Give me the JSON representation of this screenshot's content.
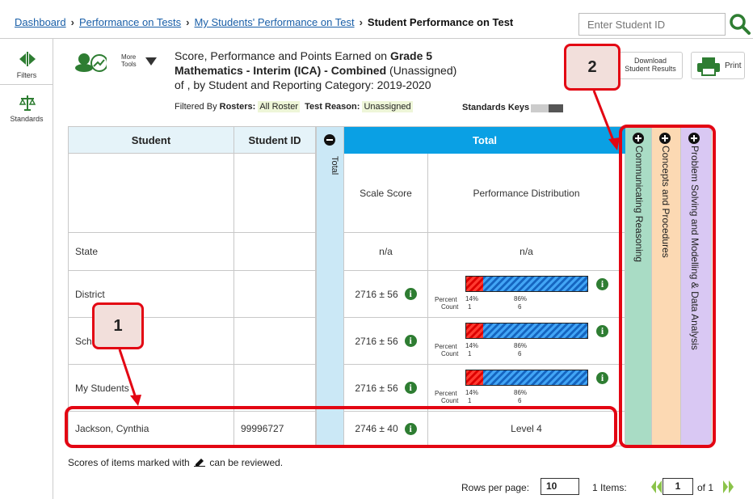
{
  "breadcrumb": {
    "items": [
      "Dashboard",
      "Performance on Tests",
      "My Students' Performance on Test"
    ],
    "current": "Student Performance on Test"
  },
  "search": {
    "placeholder": "Enter Student ID"
  },
  "rail": {
    "filters_label": "Filters",
    "standards_label": "Standards"
  },
  "toolbar": {
    "more_tools_label": "More Tools",
    "download_label_1": "Download",
    "download_label_2": "Student Results",
    "print_label": "Print"
  },
  "report": {
    "title_prefix": "Score, Performance and Points Earned on ",
    "title_grade": "Grade 5",
    "title_test": "Mathematics - Interim (ICA) - Combined",
    "title_suffix": " (Unassigned)",
    "title_line3": "of , by Student and Reporting Category: 2019-2020",
    "filtered_by": "Filtered By",
    "rosters_label": "Rosters:",
    "rosters_value": "All Roster",
    "reason_label": "Test Reason:",
    "reason_value": "Unassigned",
    "standards_keys": "Standards Keys"
  },
  "table": {
    "col_student": "Student",
    "col_student_id": "Student ID",
    "col_total_vertical": "Total",
    "total_banner": "Total",
    "col_scale_score": "Scale Score",
    "col_perf_dist": "Performance Distribution",
    "rows": [
      {
        "student": "State",
        "student_id": "",
        "score": "n/a",
        "dist_text": "n/a"
      },
      {
        "student": "District",
        "student_id": "",
        "score": "2716 ± 56",
        "pct_left": "14%",
        "pct_right": "86%",
        "cnt_left": "1",
        "cnt_right": "6"
      },
      {
        "student": "School",
        "student_id": "",
        "score": "2716 ± 56",
        "pct_left": "14%",
        "pct_right": "86%",
        "cnt_left": "1",
        "cnt_right": "6"
      },
      {
        "student": "My Students",
        "student_id": "",
        "score": "2716 ± 56",
        "pct_left": "14%",
        "pct_right": "86%",
        "cnt_left": "1",
        "cnt_right": "6"
      },
      {
        "student": "Jackson, Cynthia",
        "student_id": "99996727",
        "score": "2746 ± 40",
        "dist_text": "Level 4"
      }
    ],
    "percent_label": "Percent",
    "count_label": "Count",
    "dist_fraction_red": 0.14,
    "categories": [
      {
        "label": "Communicating Reasoning",
        "color": "#a9dcc5"
      },
      {
        "label": "Concepts and Procedures",
        "color": "#fcd9b3"
      },
      {
        "label": "Problem Solving and Modelling & Data Analysis",
        "color": "#d9c8f3"
      }
    ]
  },
  "callouts": {
    "one": "1",
    "two": "2"
  },
  "footer": {
    "note_before": "Scores of items marked with",
    "note_after": "can be reviewed.",
    "rows_per_page_label": "Rows per page:",
    "rows_per_page": "10",
    "items_label": "1 Items:",
    "page": "1",
    "of_label": "of 1"
  }
}
